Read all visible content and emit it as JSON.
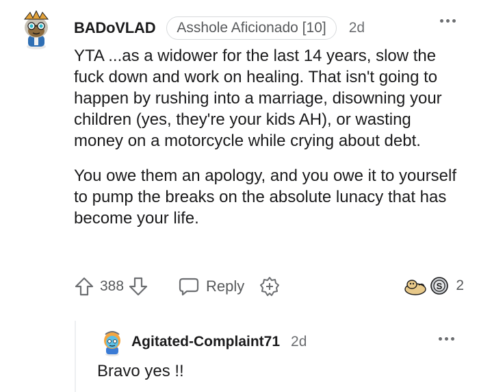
{
  "comment": {
    "username": "BADoVLAD",
    "flair": "Asshole Aficionado [10]",
    "age": "2d",
    "paragraphs": [
      "YTA ...as a widower for the last 14 years, slow the fuck down and work on healing. That isn't going to happen by rushing into a marriage, disowning your children (yes, they're your kids AH), or wasting money on a motorcycle while crying about debt.",
      "You owe them an apology, and you owe it to yourself to pump the breaks on the absolute lunacy that has become your life."
    ],
    "score": "388",
    "reply_label": "Reply",
    "award_count": "2"
  },
  "reply": {
    "username": "Agitated-Complaint71",
    "age": "2d",
    "text": "Bravo yes !!"
  },
  "icons": {
    "upvote": "arrow-up-icon",
    "downvote": "arrow-down-icon",
    "reply": "speech-bubble-icon",
    "award": "award-plus-icon",
    "more": "ellipsis-icon"
  },
  "colors": {
    "text": "#1a1a1b",
    "meta": "#6b6d70",
    "border": "#d7dadc"
  }
}
